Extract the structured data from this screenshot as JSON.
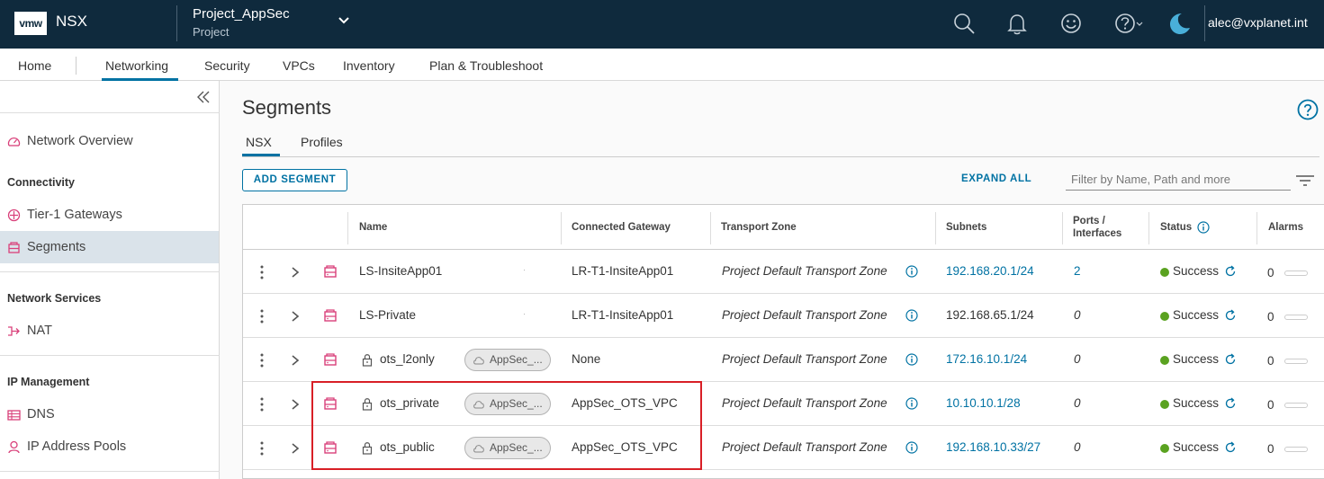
{
  "header": {
    "logo": "vmw",
    "app_name": "NSX",
    "project_name": "Project_AppSec",
    "project_sub": "Project",
    "user": "alec@vxplanet.int"
  },
  "nav": {
    "items": [
      "Home",
      "Networking",
      "Security",
      "VPCs",
      "Inventory",
      "Plan & Troubleshoot"
    ],
    "active": "Networking"
  },
  "sidebar": {
    "network_overview": "Network Overview",
    "connectivity_header": "Connectivity",
    "tier1": "Tier-1 Gateways",
    "segments": "Segments",
    "services_header": "Network Services",
    "nat": "NAT",
    "ipm_header": "IP Management",
    "dns": "DNS",
    "ip_pools": "IP Address Pools"
  },
  "main": {
    "title": "Segments",
    "tabs": [
      "NSX",
      "Profiles"
    ],
    "active_tab": "NSX",
    "add_button": "ADD SEGMENT",
    "expand_all": "EXPAND ALL",
    "filter_placeholder": "Filter by Name, Path and more"
  },
  "table": {
    "columns": {
      "name": "Name",
      "gateway": "Connected Gateway",
      "transport_zone": "Transport Zone",
      "subnets": "Subnets",
      "ports_line1": "Ports /",
      "ports_line2": "Interfaces",
      "status": "Status",
      "alarms": "Alarms"
    },
    "rows": [
      {
        "name": "LS-InsiteApp01",
        "locked": false,
        "vpc": "",
        "gateway": "LR-T1-InsiteApp01",
        "transport_zone": "Project Default Transport Zone",
        "subnet": "192.168.20.1/24",
        "subnet_link": true,
        "ports": "2",
        "ports_link": true,
        "status": "Success",
        "alarms": "0"
      },
      {
        "name": "LS-Private",
        "locked": false,
        "vpc": "",
        "gateway": "LR-T1-InsiteApp01",
        "transport_zone": "Project Default Transport Zone",
        "subnet": "192.168.65.1/24",
        "subnet_link": false,
        "ports": "0",
        "ports_link": false,
        "status": "Success",
        "alarms": "0"
      },
      {
        "name": "ots_l2only",
        "locked": true,
        "vpc": "AppSec_...",
        "gateway": "None",
        "transport_zone": "Project Default Transport Zone",
        "subnet": "172.16.10.1/24",
        "subnet_link": true,
        "ports": "0",
        "ports_link": false,
        "status": "Success",
        "alarms": "0"
      },
      {
        "name": "ots_private",
        "locked": true,
        "vpc": "AppSec_...",
        "gateway": "AppSec_OTS_VPC",
        "transport_zone": "Project Default Transport Zone",
        "subnet": "10.10.10.1/28",
        "subnet_link": true,
        "ports": "0",
        "ports_link": false,
        "status": "Success",
        "alarms": "0"
      },
      {
        "name": "ots_public",
        "locked": true,
        "vpc": "AppSec_...",
        "gateway": "AppSec_OTS_VPC",
        "transport_zone": "Project Default Transport Zone",
        "subnet": "192.168.10.33/27",
        "subnet_link": true,
        "ports": "0",
        "ports_link": false,
        "status": "Success",
        "alarms": "0"
      }
    ]
  },
  "colors": {
    "header_bg": "#0f2a3d",
    "accent": "#0072a3",
    "success": "#5aa220",
    "segment_icon": "#d9407a",
    "highlight": "#d81f26"
  },
  "icons": {
    "header": [
      "search-icon",
      "bell-icon",
      "smiley-icon",
      "help-icon",
      "moon-icon"
    ],
    "sidebar": [
      "dashboard-icon",
      "router-icon",
      "segment-icon",
      "nat-icon",
      "dns-icon",
      "ip-pool-icon"
    ]
  }
}
